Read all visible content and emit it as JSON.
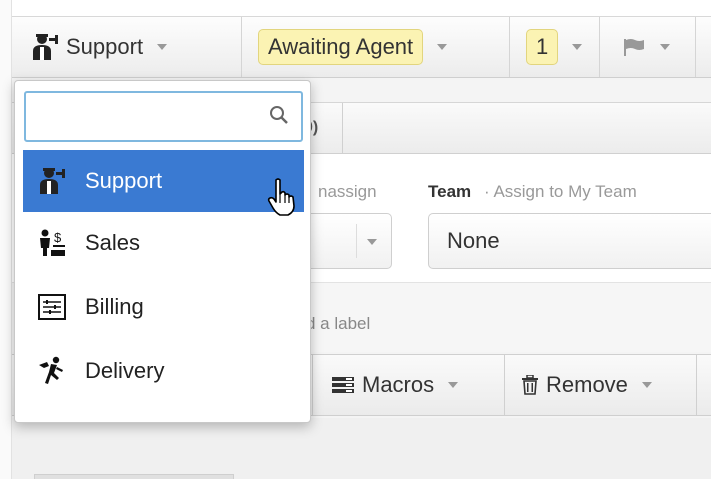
{
  "toolbar": {
    "group_label": "Support",
    "status_label": "Awaiting Agent",
    "priority_label": "1",
    "icons": {
      "group": "support-agent-icon",
      "flag": "flag-icon"
    }
  },
  "ticket": {
    "tab_count": "0)",
    "assign_hint": "nassign",
    "team_title": "Team",
    "team_subtitle": "· Assign to My Team",
    "team_value": "None",
    "label_hint": "d a label"
  },
  "actions": {
    "macros_label": "Macros",
    "remove_label": "Remove"
  },
  "dropdown": {
    "search_value": "",
    "items": [
      {
        "label": "Support",
        "icon": "support-agent-icon",
        "selected": true
      },
      {
        "label": "Sales",
        "icon": "sales-icon",
        "selected": false
      },
      {
        "label": "Billing",
        "icon": "billing-icon",
        "selected": false
      },
      {
        "label": "Delivery",
        "icon": "delivery-icon",
        "selected": false
      }
    ]
  },
  "colors": {
    "selected_bg": "#3a7ad2",
    "badge_bg": "#fbf3b3",
    "search_border": "#7fb8df"
  }
}
